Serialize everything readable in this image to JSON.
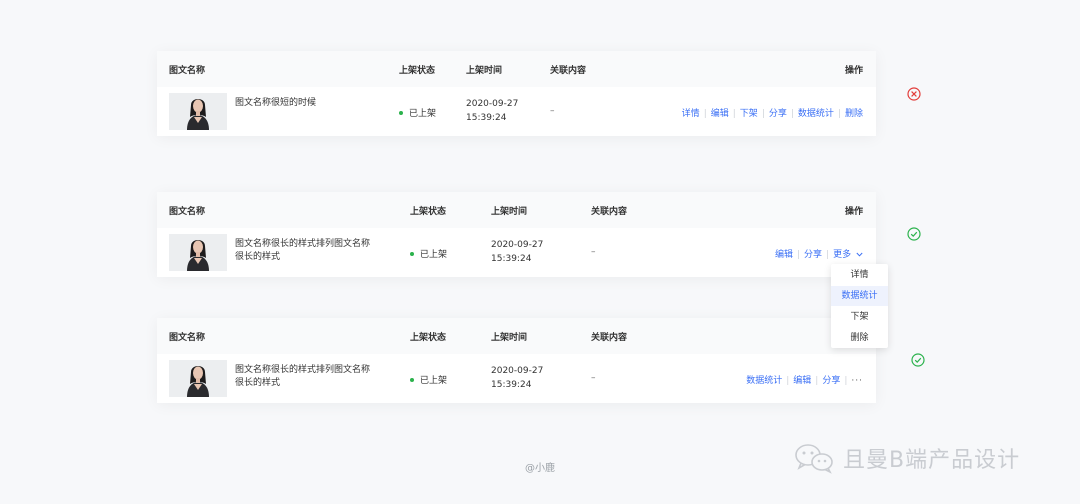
{
  "tables": [
    {
      "headers": {
        "name": "图文名称",
        "status": "上架状态",
        "time": "上架时间",
        "related": "关联内容",
        "actions": "操作"
      },
      "row": {
        "name": "图文名称很短的时候",
        "status": "已上架",
        "time_date": "2020-09-27",
        "time_clock": "15:39:24",
        "related": "–",
        "actions": [
          "详情",
          "编辑",
          "下架",
          "分享",
          "数据统计",
          "删除"
        ]
      },
      "badge": "error-icon"
    },
    {
      "headers": {
        "name": "图文名称",
        "status": "上架状态",
        "time": "上架时间",
        "related": "关联内容",
        "actions": "操作"
      },
      "row": {
        "name": "图文名称很长的样式排列图文名称很长的样式",
        "status": "已上架",
        "time_date": "2020-09-27",
        "time_clock": "15:39:24",
        "related": "–",
        "actions": [
          "编辑",
          "分享"
        ],
        "more_label": "更多"
      },
      "dropdown": [
        "详情",
        "数据统计",
        "下架",
        "删除"
      ],
      "dropdown_active": "数据统计",
      "badge": "check-icon"
    },
    {
      "headers": {
        "name": "图文名称",
        "status": "上架状态",
        "time": "上架时间",
        "related": "关联内容",
        "actions": "操作"
      },
      "row": {
        "name": "图文名称很长的样式排列图文名称很长的样式",
        "status": "已上架",
        "time_date": "2020-09-27",
        "time_clock": "15:39:24",
        "related": "–",
        "actions": [
          "数据统计",
          "编辑",
          "分享"
        ],
        "more_label": "···"
      },
      "badge": "check-icon"
    }
  ],
  "footer": {
    "credit": "@小鹿"
  },
  "watermark": {
    "text": "且曼B端产品设计"
  },
  "colors": {
    "link": "#3a6ff5",
    "success": "#2bb24c",
    "error": "#e23c39"
  }
}
